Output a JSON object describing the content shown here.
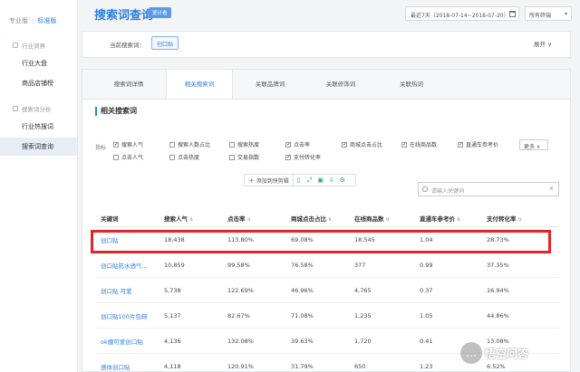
{
  "sidebar": {
    "version_pro": "专业版",
    "version_std": "标准版",
    "sections": [
      {
        "label": "行业洞察",
        "items": [
          "行业大盘",
          "商品店铺榜"
        ]
      },
      {
        "label": "搜索词分析",
        "items": [
          "行业热搜词",
          "搜索词查询"
        ]
      }
    ],
    "active_item": "搜索词查询"
  },
  "header": {
    "title": "搜索词查询",
    "tag": "爱计看",
    "date_range": "最近7天（2018-07-14~2018-07-20）",
    "terminal": "所有终端"
  },
  "filter": {
    "current_label": "当前搜索词：",
    "current_word": "创口贴",
    "expand": "展开"
  },
  "tabs": [
    "搜索词详情",
    "相关搜索词",
    "关联品牌词",
    "关联修饰词",
    "关联热词"
  ],
  "active_tab": "相关搜索词",
  "section_title": "相关搜索词",
  "metrics": {
    "label": "指标",
    "items": [
      {
        "label": "搜索人气",
        "checked": true
      },
      {
        "label": "搜索人数占比",
        "checked": false
      },
      {
        "label": "搜索热度",
        "checked": false
      },
      {
        "label": "点击率",
        "checked": true
      },
      {
        "label": "商城点击占比",
        "checked": true
      },
      {
        "label": "在线商品数",
        "checked": true
      },
      {
        "label": "直通车参考价",
        "checked": true
      },
      {
        "label": "点击人气",
        "checked": false
      },
      {
        "label": "点击热度",
        "checked": false
      },
      {
        "label": "交易指数",
        "checked": false
      },
      {
        "label": "支付转化率",
        "checked": true
      }
    ],
    "more": "更多"
  },
  "toolbar": {
    "add_label": "添加到快剪辑"
  },
  "search": {
    "placeholder": "请输入关键词"
  },
  "table": {
    "headers": [
      "关键词",
      "搜索人气",
      "点击率",
      "商城点击占比",
      "在线商品数",
      "直通车参考价",
      "支付转化率"
    ],
    "rows": [
      [
        "创口贴",
        "18,438",
        "113.80%",
        "69.08%",
        "18,545",
        "1.04",
        "28.73%"
      ],
      [
        "创口贴防水透气...",
        "10,859",
        "99.58%",
        "76.58%",
        "377",
        "0.99",
        "37.35%"
      ],
      [
        "创口贴 可爱",
        "5,738",
        "122.69%",
        "46.96%",
        "4,765",
        "0.37",
        "16.94%"
      ],
      [
        "创口贴100片包邮",
        "5,137",
        "82.67%",
        "71.08%",
        "1,235",
        "1.05",
        "44.86%"
      ],
      [
        "ok绷可爱创口贴",
        "4,136",
        "132.08%",
        "39.63%",
        "1,720",
        "0.41",
        "13.08%"
      ],
      [
        "透体创口贴",
        "4,118",
        "120.91%",
        "31.79%",
        "650",
        "1.23",
        "6.52%"
      ]
    ]
  },
  "watermark": "悟空问答"
}
